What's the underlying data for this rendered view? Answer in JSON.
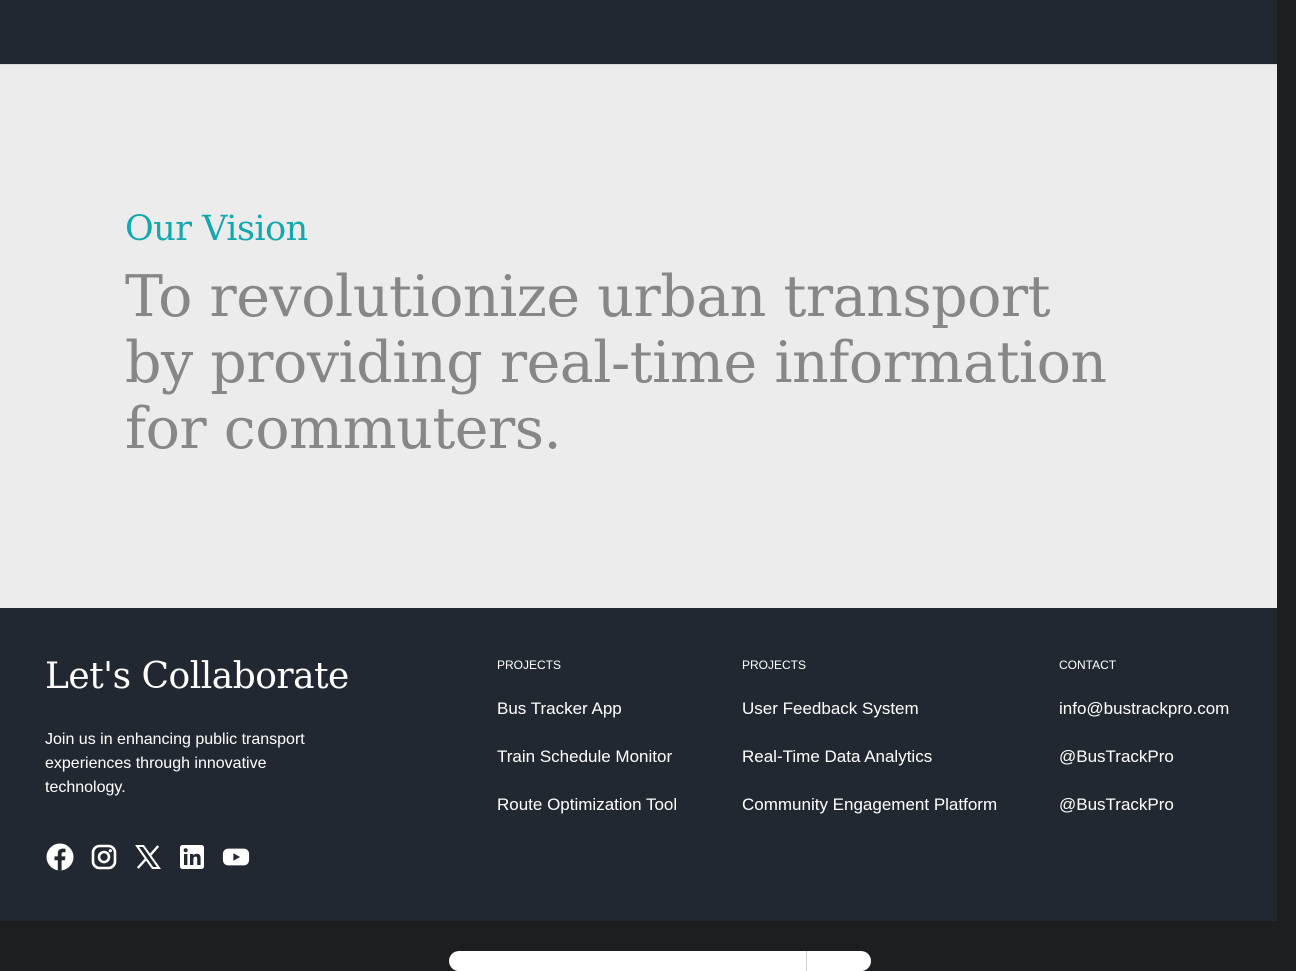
{
  "vision": {
    "eyebrow": "Our Vision",
    "statement": "To revolutionize urban transport by providing real-time information for commuters."
  },
  "footer": {
    "title": "Let's Collaborate",
    "description": "Join us in enhancing public transport experiences through innovative technology.",
    "socials": [
      {
        "icon": "facebook-icon"
      },
      {
        "icon": "instagram-icon"
      },
      {
        "icon": "x-icon"
      },
      {
        "icon": "linkedin-icon"
      },
      {
        "icon": "youtube-icon"
      }
    ],
    "columns": [
      {
        "heading": "PROJECTS",
        "links": [
          "Bus Tracker App",
          "Train Schedule Monitor",
          "Route Optimization Tool"
        ]
      },
      {
        "heading": "PROJECTS",
        "links": [
          "User Feedback System",
          "Real-Time Data Analytics",
          "Community Engagement Platform"
        ]
      },
      {
        "heading": "CONTACT",
        "links": [
          "info@bustrackpro.com",
          "@BusTrackPro",
          "@BusTrackPro"
        ]
      }
    ]
  },
  "colors": {
    "dark_navy": "#222831",
    "accent_teal": "#13a8ad",
    "vision_bg": "#ececec",
    "vision_text": "#878787"
  }
}
